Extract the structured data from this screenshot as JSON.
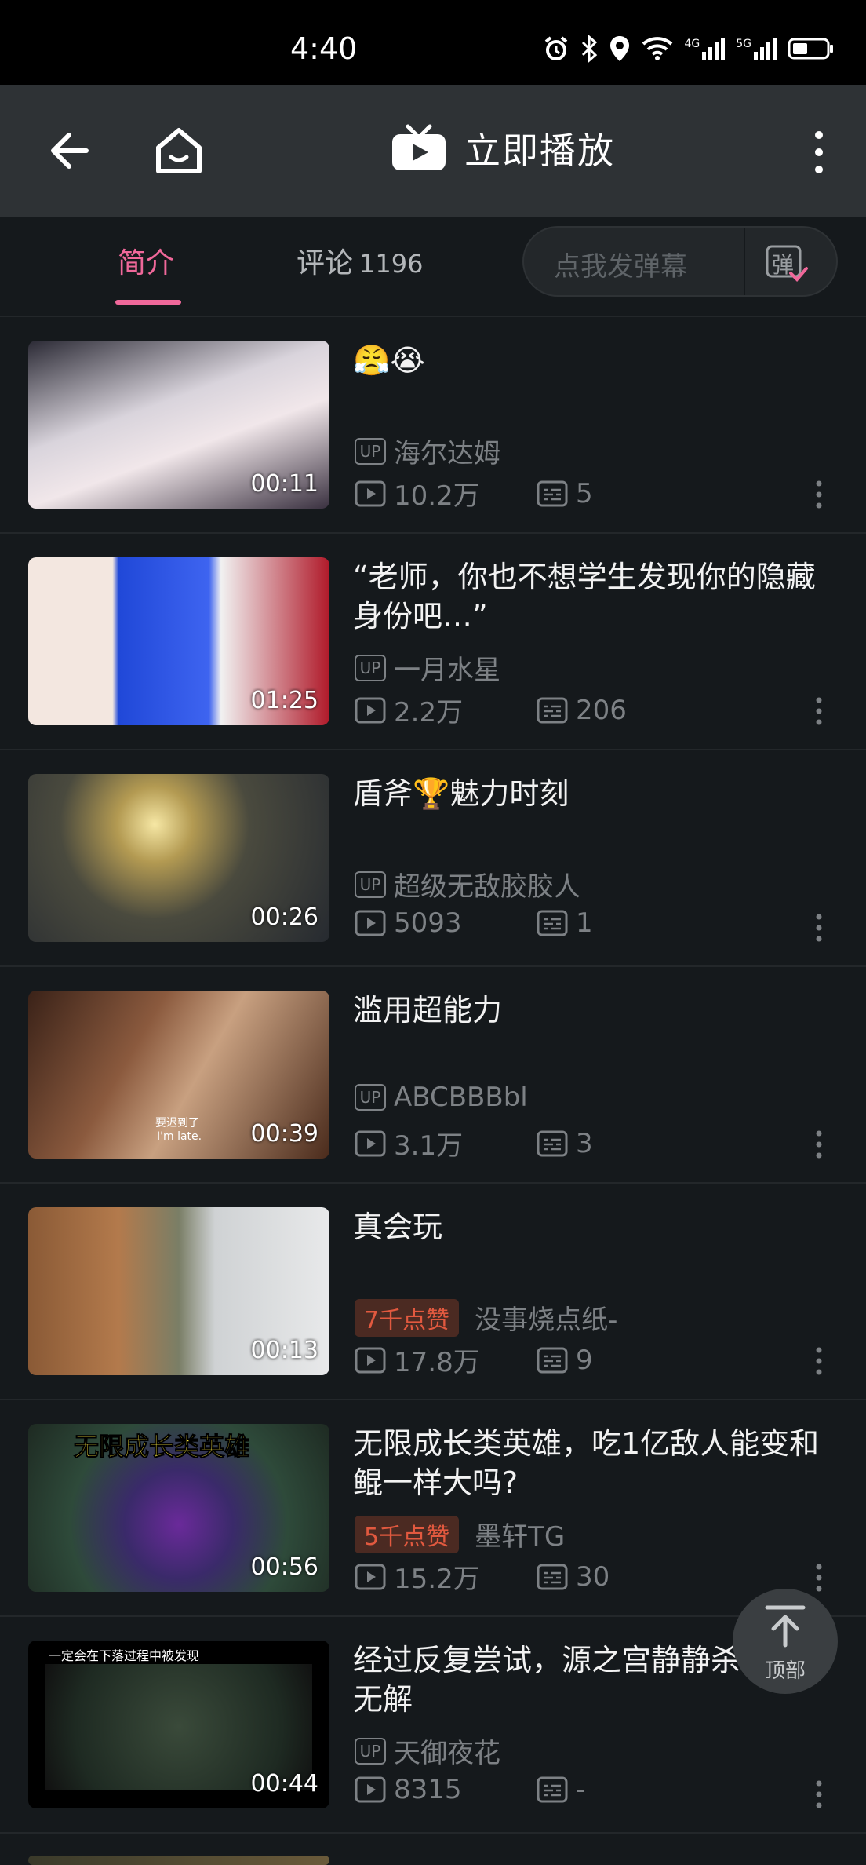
{
  "status_bar": {
    "time": "4:40",
    "net1": "4G",
    "net2": "5G"
  },
  "app_bar": {
    "title": "立即播放"
  },
  "tabs": {
    "intro": "简介",
    "comments": "评论",
    "comments_count": "1196"
  },
  "danmaku": {
    "placeholder": "点我发弹幕",
    "toggle_glyph": "弹"
  },
  "videos": [
    {
      "title": "😤😭",
      "up": "海尔达姆",
      "likes_badge": "",
      "views": "10.2万",
      "danmaku": "5",
      "duration": "00:11"
    },
    {
      "title": "“老师，你也不想学生发现你的隐藏身份吧…”",
      "up": "一月水星",
      "likes_badge": "",
      "views": "2.2万",
      "danmaku": "206",
      "duration": "01:25"
    },
    {
      "title": "盾斧🏆魅力时刻",
      "up": "超级无敌胶胶人",
      "likes_badge": "",
      "views": "5093",
      "danmaku": "1",
      "duration": "00:26"
    },
    {
      "title": "滥用超能力",
      "up": "ABCBBBbl",
      "likes_badge": "",
      "views": "3.1万",
      "danmaku": "3",
      "duration": "00:39",
      "thumb_caption_cn": "要迟到了",
      "thumb_caption_en": "I'm late."
    },
    {
      "title": "真会玩",
      "up": "没事烧点纸-",
      "likes_badge": "7千点赞",
      "views": "17.8万",
      "danmaku": "9",
      "duration": "00:13"
    },
    {
      "title": "无限成长类英雄，吃1亿敌人能变和鲲一样大吗?",
      "up": "墨轩TG",
      "likes_badge": "5千点赞",
      "views": "15.2万",
      "danmaku": "30",
      "duration": "00:56",
      "thumb_caption": "无限成长类英雄"
    },
    {
      "title": "经过反复尝试，源之宫静静杀方法为无解",
      "up": "天御夜花",
      "likes_badge": "",
      "views": "8315",
      "danmaku": "-",
      "duration": "00:44",
      "thumb_caption": "一定会在下落过程中被发现"
    }
  ],
  "back_to_top": {
    "label": "顶部"
  },
  "colors": {
    "accent": "#f0689a",
    "background": "#15191c",
    "app_bar": "#2e3235",
    "muted": "#7d8185",
    "likes_badge": "#e2593f"
  }
}
